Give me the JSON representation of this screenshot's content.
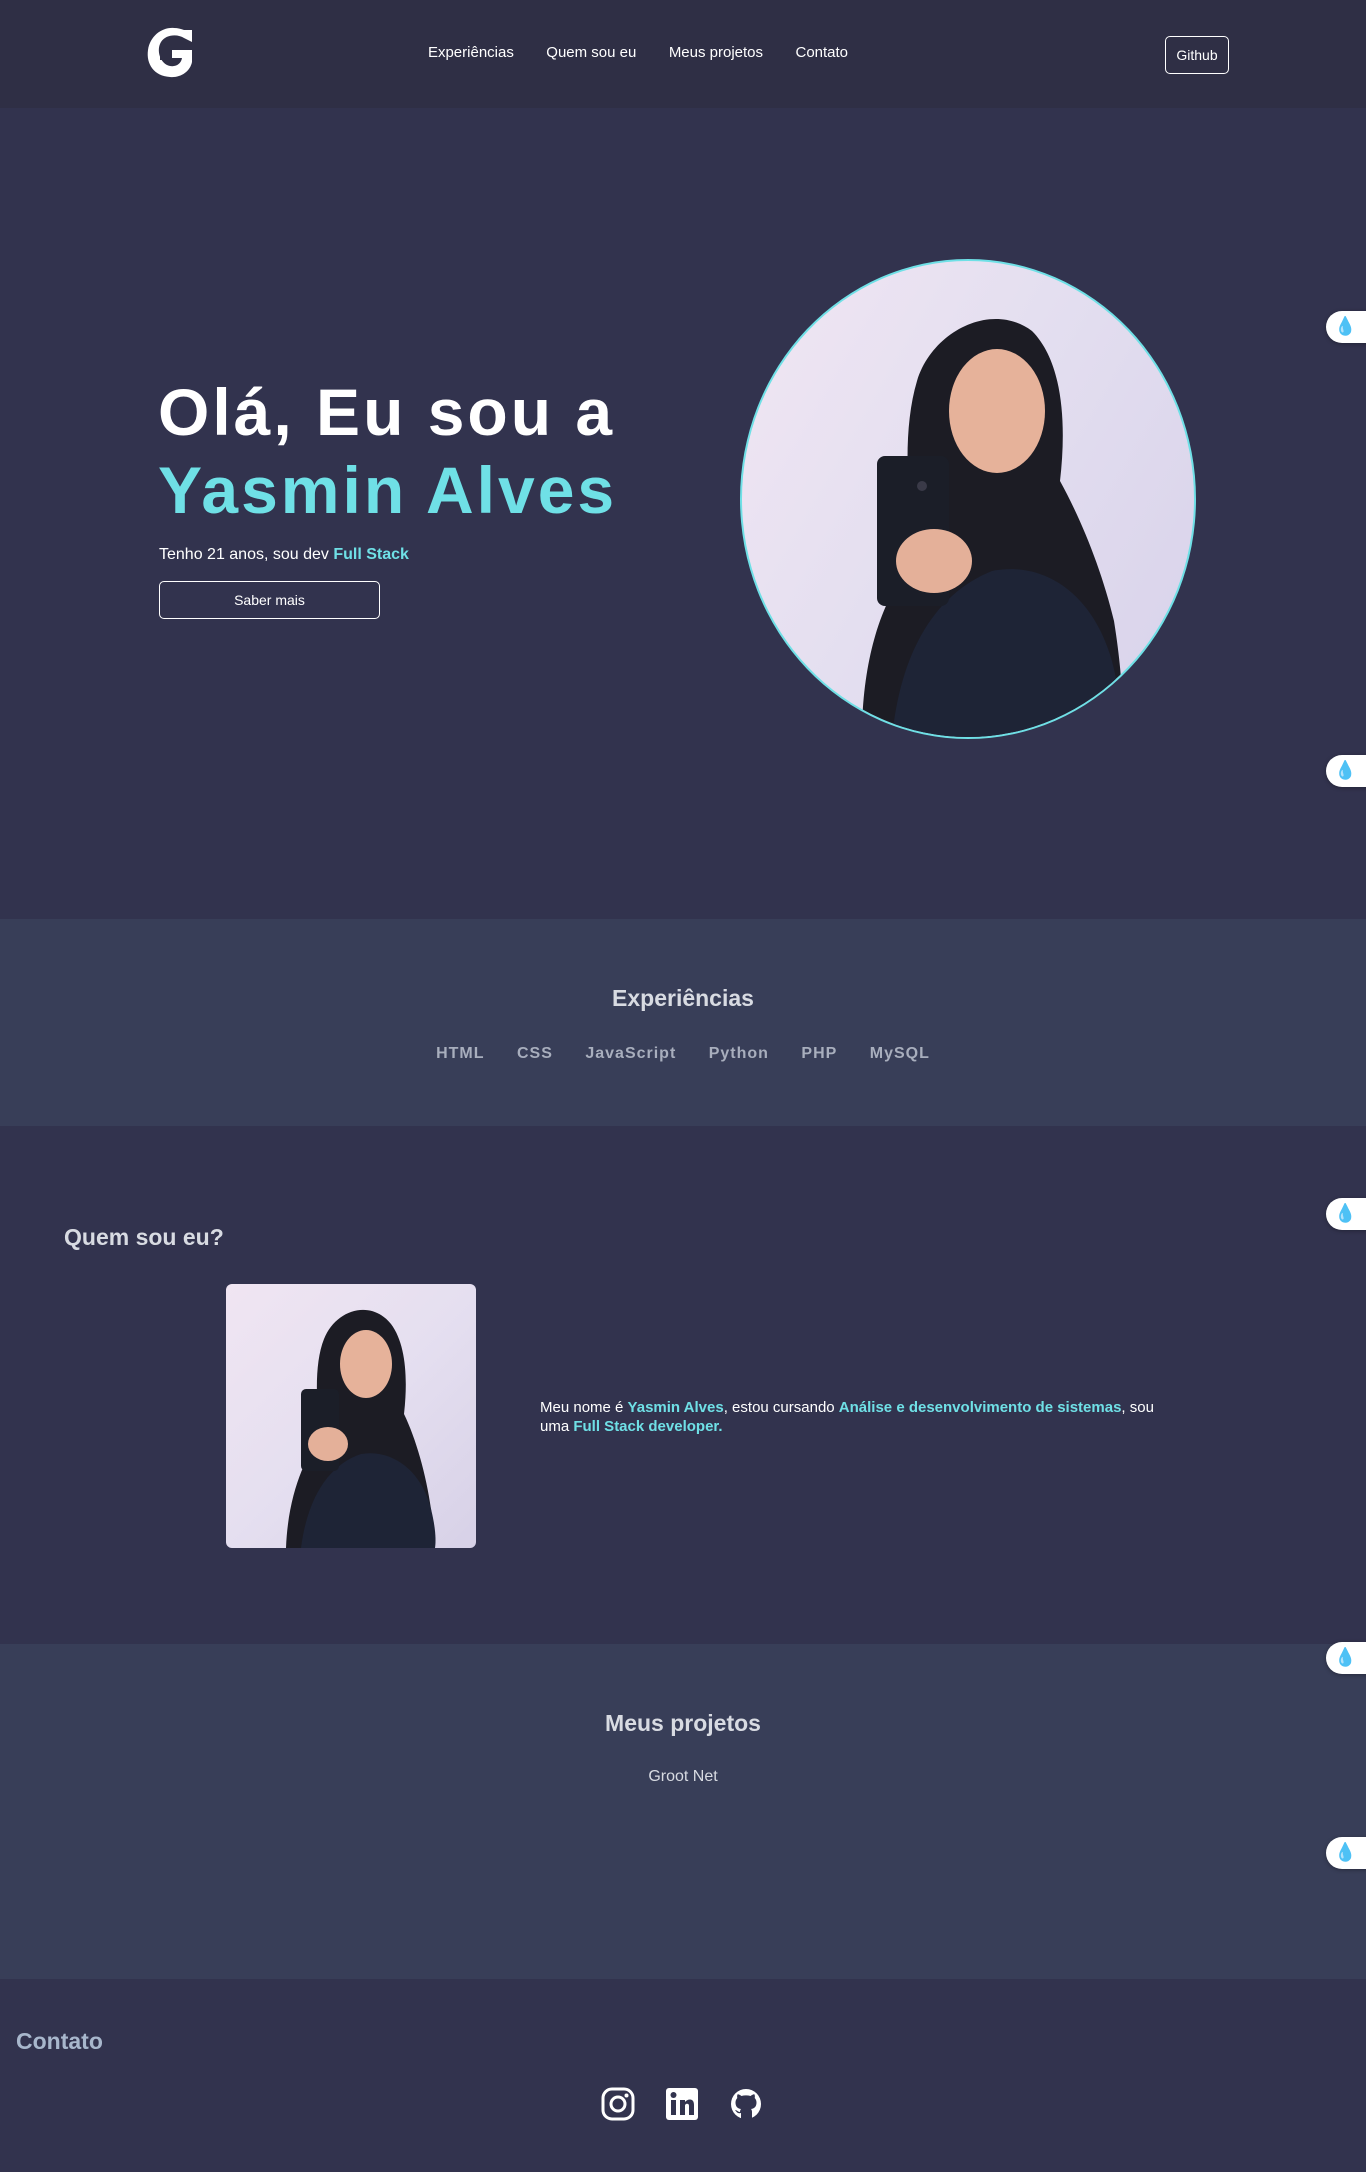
{
  "header": {
    "logo_letter": "G",
    "nav": [
      {
        "label": "Experiências"
      },
      {
        "label": "Quem sou eu"
      },
      {
        "label": "Meus projetos"
      },
      {
        "label": "Contato"
      }
    ],
    "github_label": "Github"
  },
  "hero": {
    "line1": "Olá, Eu sou a",
    "line2": "Yasmin Alves",
    "sub_prefix": "Tenho 21 anos, sou dev ",
    "sub_highlight": "Full Stack",
    "button_label": "Saber mais"
  },
  "experiences": {
    "title": "Experiências",
    "skills": [
      "HTML",
      "CSS",
      "JavaScript",
      "Python",
      "PHP",
      "MySQL"
    ]
  },
  "about": {
    "title": "Quem sou eu?",
    "t1": "Meu nome é ",
    "name": "Yasmin Alves",
    "t2": ", estou cursando ",
    "course": "Análise e desenvolvimento de sistemas",
    "t3": ", sou uma ",
    "role": "Full Stack developer."
  },
  "projects": {
    "title": "Meus projetos",
    "items": [
      "Groot Net"
    ]
  },
  "contact": {
    "title": "Contato",
    "icons": [
      "instagram-icon",
      "linkedin-icon",
      "github-icon"
    ]
  },
  "colors": {
    "background": "#32334e",
    "header": "#2f2f45",
    "section_alt": "#383e58",
    "accent": "#6fe0e6"
  }
}
